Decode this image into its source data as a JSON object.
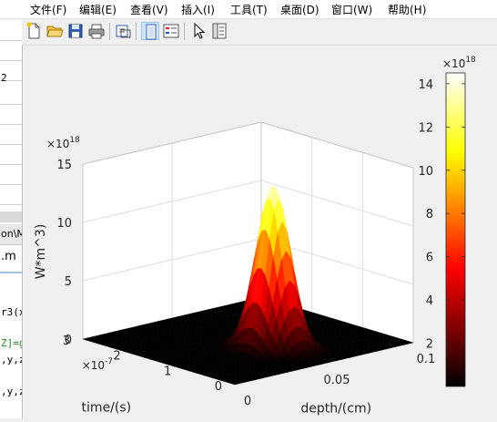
{
  "menubar": {
    "items": [
      {
        "label": "文件(F)"
      },
      {
        "label": "编辑(E)"
      },
      {
        "label": "查看(V)"
      },
      {
        "label": "插入(I)"
      },
      {
        "label": "工具(T)"
      },
      {
        "label": "桌面(D)"
      },
      {
        "label": "窗口(W)"
      },
      {
        "label": "帮助(H)"
      }
    ]
  },
  "toolbar": {
    "buttons": [
      "new-file-icon",
      "open-folder-icon",
      "save-icon",
      "print-icon",
      "print-preview-icon",
      "figure-link-icon",
      "insert-legend-icon",
      "pointer-icon",
      "property-editor-icon"
    ],
    "active": "figure-link-icon"
  },
  "background_window": {
    "lines": [
      "2",
      "on\\M",
      ".m",
      "r3(x",
      "Z]=g",
      ",y,z",
      ",y,z"
    ]
  },
  "chart_data": {
    "type": "surface",
    "colormap": "hot",
    "x_label": "depth/(cm)",
    "y_label": "time/(s)",
    "z_label": "W*m^3)",
    "x_ticks": [
      "0",
      "0.05",
      "0.1"
    ],
    "y_ticks": [
      "0",
      "1",
      "2",
      "3"
    ],
    "y_exponent": "×10",
    "y_exponent_power": "-7",
    "z_ticks": [
      "0",
      "5",
      "10",
      "15"
    ],
    "z_exponent": "×10",
    "z_exponent_power": "18",
    "x_range": [
      0,
      0.1
    ],
    "y_range": [
      0,
      3e-07
    ],
    "z_range": [
      0,
      1.5e+19
    ],
    "peak": {
      "depth": 0.05,
      "time": 1e-07,
      "value": 1.4e+19
    },
    "colorbar": {
      "ticks": [
        "2",
        "4",
        "6",
        "8",
        "10",
        "12",
        "14"
      ],
      "exponent": "×10",
      "exponent_power": "18",
      "range": [
        0,
        1.45e+19
      ]
    },
    "grid": true
  }
}
